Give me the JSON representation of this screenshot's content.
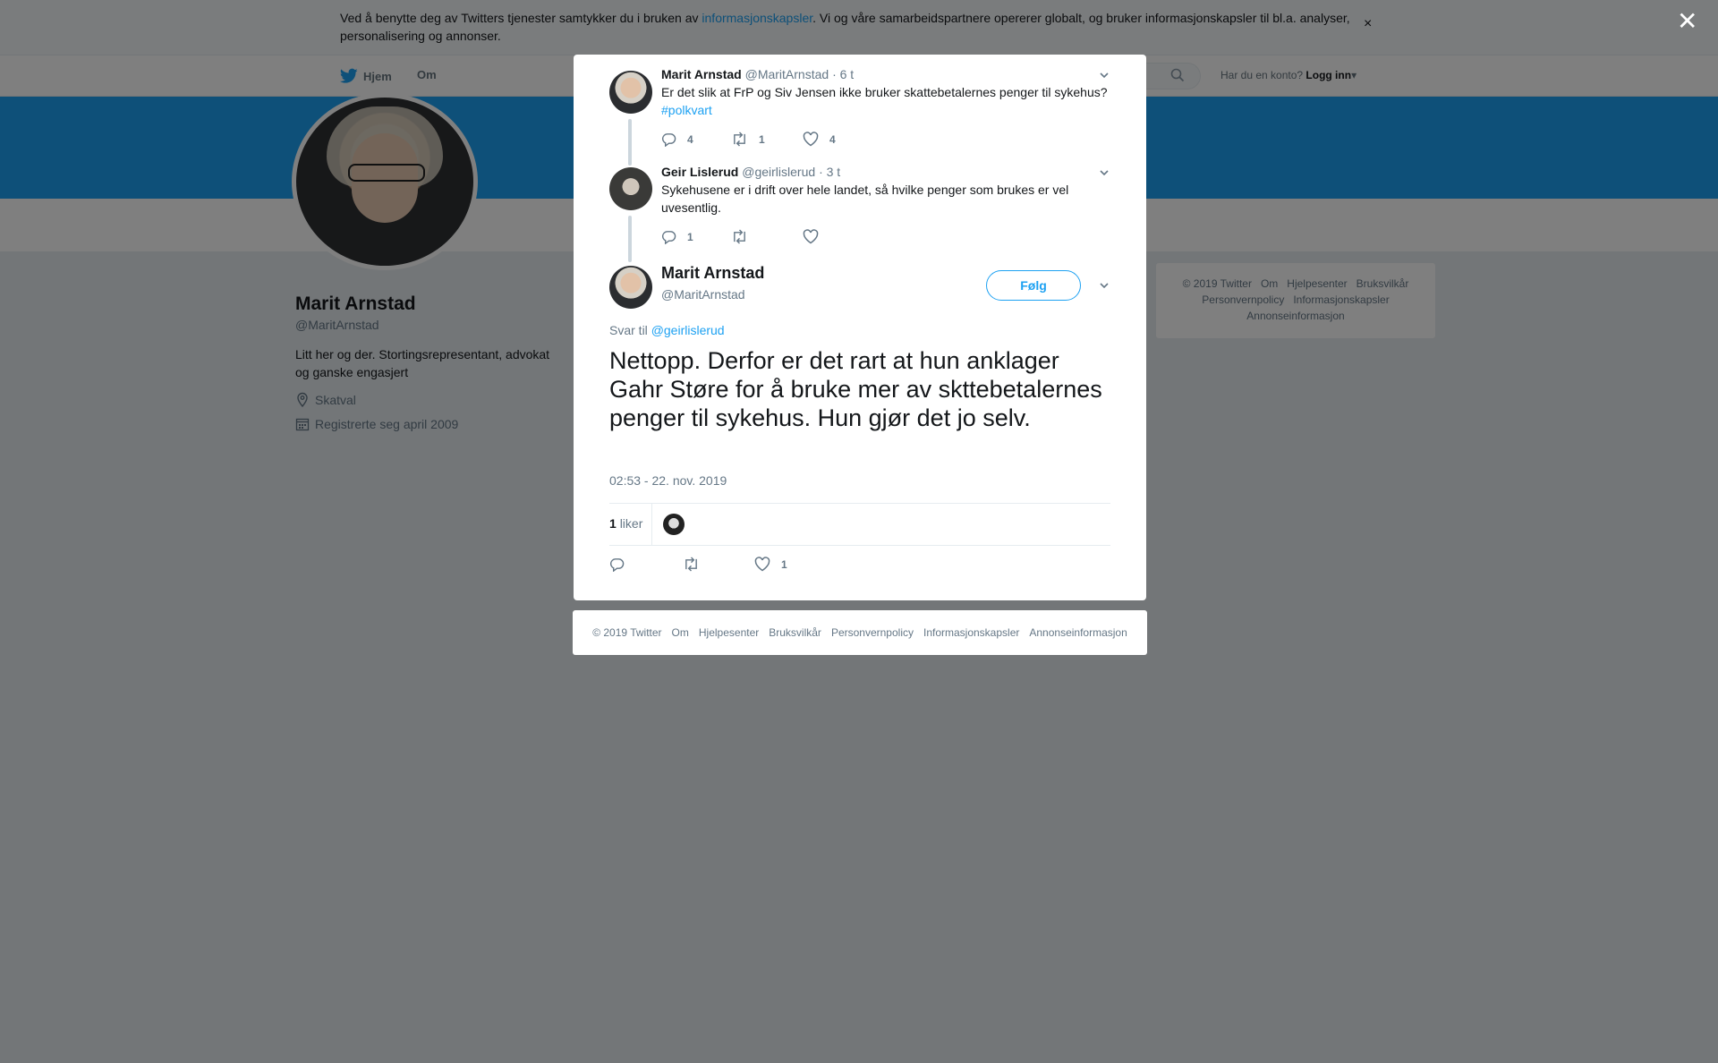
{
  "cookie_bar": {
    "text_before": "Ved å benytte deg av Twitters tjenester samtykker du i bruken av ",
    "link": "informasjonskapsler",
    "text_after": ". Vi og våre samarbeidspartnere opererer globalt, og bruker informasjonskapsler til bl.a. analyser, personalisering og annonser.",
    "close": "×"
  },
  "nav": {
    "home": "Hjem",
    "about": "Om",
    "login_prompt": "Har du en konto?",
    "login": "Logg inn"
  },
  "profile": {
    "name": "Marit Arnstad",
    "handle": "@MaritArnstad",
    "bio": "Litt her og der. Stortingsrepresentant, advokat og ganske engasjert",
    "location": "Skatval",
    "joined": "Registrerte seg april 2009"
  },
  "side_footer": {
    "line1": [
      "© 2019 Twitter",
      "Om",
      "Hjelpesenter",
      "Bruksvilkår"
    ],
    "line2": [
      "Personvernpolicy",
      "Informasjonskapsler"
    ],
    "line3": [
      "Annonseinformasjon"
    ]
  },
  "overlay": {
    "close": "✕"
  },
  "thread": [
    {
      "name": "Marit Arnstad",
      "handle": "@MaritArnstad",
      "time": "· 6 t",
      "text": "Er det slik at FrP og Siv Jensen ikke bruker skattebetalernes penger til sykehus?",
      "hashtag": "#polkvart",
      "replies": "4",
      "retweets": "1",
      "likes": "4"
    },
    {
      "name": "Geir Lislerud",
      "handle": "@geirlislerud",
      "time": "· 3 t",
      "text": "Sykehusene er i drift over hele landet, så hvilke penger som brukes er vel uvesentlig.",
      "replies": "1",
      "retweets": "",
      "likes": ""
    }
  ],
  "main_tweet": {
    "name": "Marit Arnstad",
    "handle": "@MaritArnstad",
    "follow": "Følg",
    "reply_prefix": "Svar til",
    "reply_to": "@geirlislerud",
    "text": "Nettopp. Derfor er det rart at hun anklager Gahr Støre for å bruke mer av skttebetalernes penger til sykehus. Hun gjør det jo selv.",
    "timestamp": "02:53 - 22. nov. 2019",
    "likes_count": "1",
    "likes_label": "liker",
    "action_likes": "1"
  },
  "modal_footer": [
    "© 2019 Twitter",
    "Om",
    "Hjelpesenter",
    "Bruksvilkår",
    "Personvernpolicy",
    "Informasjonskapsler",
    "Annonseinformasjon"
  ],
  "colors": {
    "accent": "#1da1f2",
    "text_secondary": "#657786",
    "thread_line": "#ccd6dd"
  }
}
